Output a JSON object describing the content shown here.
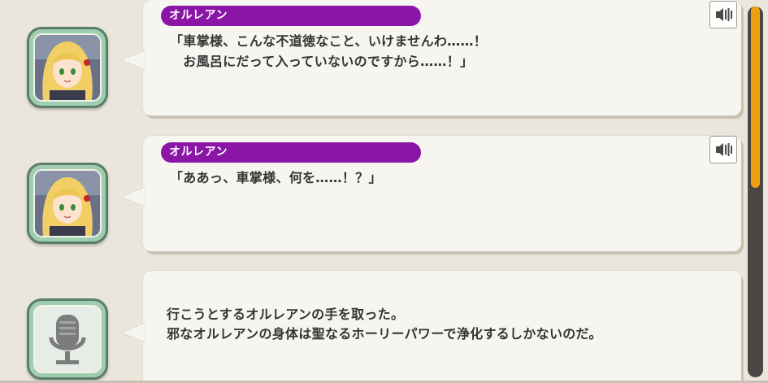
{
  "log": {
    "entries": [
      {
        "speaker": "オルレアン",
        "lines": [
          "「車掌様、こんな不道徳なこと、いけませんわ……！",
          "　お風呂にだって入っていないのですから……！」"
        ],
        "avatar": "orleans-portrait",
        "voice_icon": "speaker-icon"
      },
      {
        "speaker": "オルレアン",
        "lines": [
          "「ああっ、車掌様、何を……！？」"
        ],
        "avatar": "orleans-portrait",
        "voice_icon": "speaker-icon"
      },
      {
        "speaker": "",
        "lines": [
          "行こうとするオルレアンの手を取った。",
          "邪なオルレアンの身体は聖なるホーリーパワーで浄化するしかないのだ。"
        ],
        "avatar": "narrator-microphone-icon"
      }
    ]
  },
  "colors": {
    "name_tag": "#8a15a6",
    "scroll_thumb": "#f0a00e",
    "avatar_frame": "#9fcdb0",
    "background": "#ebe6dc"
  },
  "scroll": {
    "position_fraction": 0.0,
    "visible_fraction": 0.49
  }
}
